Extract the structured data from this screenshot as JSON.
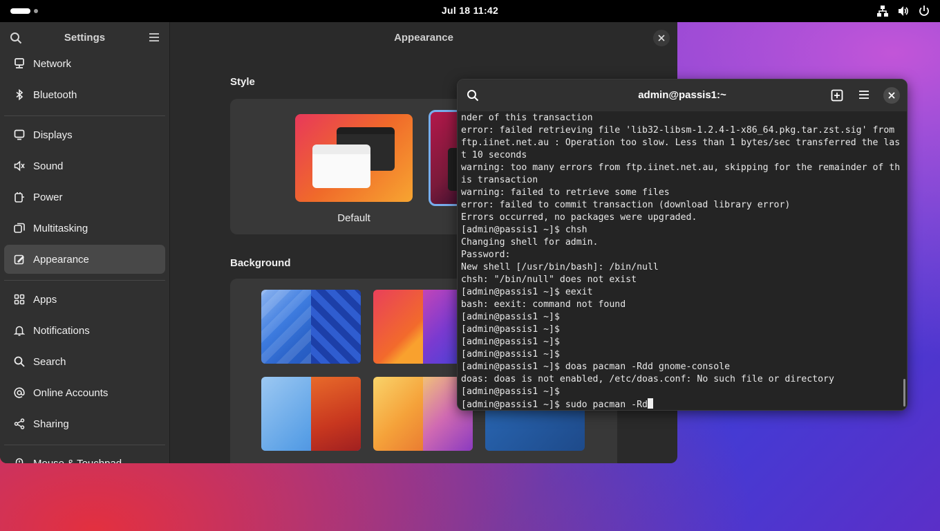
{
  "topbar": {
    "clock": "Jul 18  11:42",
    "tray_icons": [
      "network-wired-icon",
      "volume-icon",
      "power-icon"
    ]
  },
  "settings": {
    "title": "Settings",
    "page_title": "Appearance",
    "sidebar": {
      "items": [
        {
          "label": "Network",
          "icon": "network-icon"
        },
        {
          "label": "Bluetooth",
          "icon": "bluetooth-icon"
        },
        {
          "label": "Displays",
          "icon": "display-icon"
        },
        {
          "label": "Sound",
          "icon": "sound-icon"
        },
        {
          "label": "Power",
          "icon": "power-icon"
        },
        {
          "label": "Multitasking",
          "icon": "multitasking-icon"
        },
        {
          "label": "Appearance",
          "icon": "appearance-icon",
          "active": true
        },
        {
          "label": "Apps",
          "icon": "apps-icon"
        },
        {
          "label": "Notifications",
          "icon": "bell-icon"
        },
        {
          "label": "Search",
          "icon": "search-icon"
        },
        {
          "label": "Online Accounts",
          "icon": "at-sign-icon"
        },
        {
          "label": "Sharing",
          "icon": "share-icon"
        },
        {
          "label": "Mouse & Touchpad",
          "icon": "mouse-icon"
        }
      ]
    },
    "style_section": {
      "title": "Style",
      "options": [
        {
          "label": "Default"
        }
      ]
    },
    "background_section": {
      "title": "Background"
    },
    "accent_color": "#78aeed"
  },
  "terminal": {
    "title": "admin@passis1:~",
    "lines": [
      "nder of this transaction",
      "error: failed retrieving file 'lib32-libsm-1.2.4-1-x86_64.pkg.tar.zst.sig' from",
      "ftp.iinet.net.au : Operation too slow. Less than 1 bytes/sec transferred the las",
      "t 10 seconds",
      "warning: too many errors from ftp.iinet.net.au, skipping for the remainder of th",
      "is transaction",
      "warning: failed to retrieve some files",
      "error: failed to commit transaction (download library error)",
      "Errors occurred, no packages were upgraded.",
      "[admin@passis1 ~]$ chsh",
      "Changing shell for admin.",
      "Password:",
      "New shell [/usr/bin/bash]: /bin/null",
      "chsh: \"/bin/null\" does not exist",
      "[admin@passis1 ~]$ eexit",
      "bash: eexit: command not found",
      "[admin@passis1 ~]$",
      "[admin@passis1 ~]$",
      "[admin@passis1 ~]$",
      "[admin@passis1 ~]$",
      "[admin@passis1 ~]$ doas pacman -Rdd gnome-console",
      "doas: doas is not enabled, /etc/doas.conf: No such file or directory",
      "[admin@passis1 ~]$"
    ],
    "prompt_line": "[admin@passis1 ~]$ sudo pacman -Rd"
  }
}
